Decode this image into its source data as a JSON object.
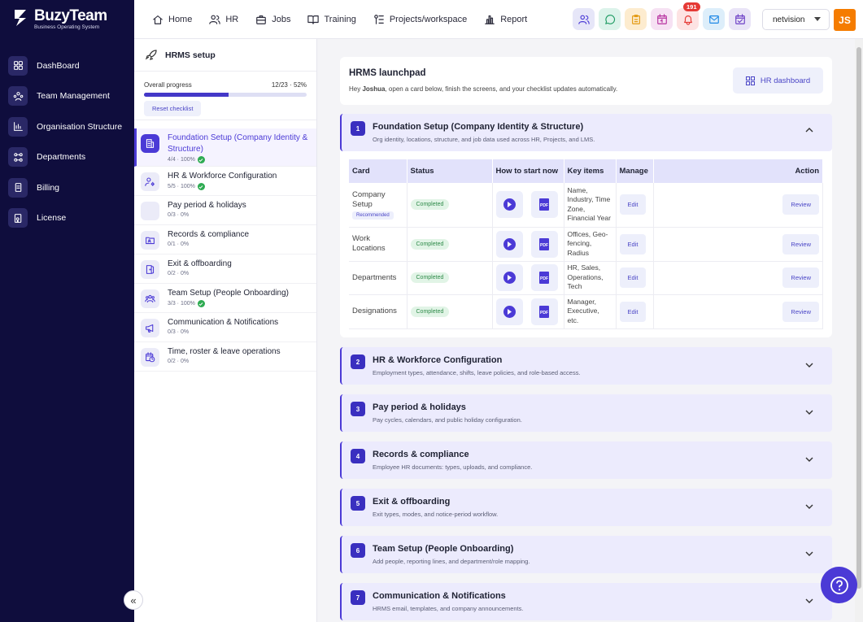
{
  "app": {
    "brand": "BuzyTeam",
    "tagline": "Business Operating System"
  },
  "leftnav": [
    {
      "label": "DashBoard",
      "icon": "dashboard-icon"
    },
    {
      "label": "Team Management",
      "icon": "team-icon"
    },
    {
      "label": "Organisation Structure",
      "icon": "org-chart-icon"
    },
    {
      "label": "Departments",
      "icon": "departments-icon"
    },
    {
      "label": "Billing",
      "icon": "billing-icon"
    },
    {
      "label": "License",
      "icon": "license-icon"
    }
  ],
  "collapse_glyph": "«",
  "topnav": [
    {
      "label": "Home",
      "icon": "home-icon"
    },
    {
      "label": "HR",
      "icon": "people-icon"
    },
    {
      "label": "Jobs",
      "icon": "briefcase-icon"
    },
    {
      "label": "Training",
      "icon": "book-icon"
    },
    {
      "label": "Projects/workspace",
      "icon": "projects-icon"
    },
    {
      "label": "Report",
      "icon": "bar-chart-icon"
    }
  ],
  "toolbar": {
    "icons": [
      {
        "name": "users-icon",
        "bg": "#e6e6f8",
        "color": "#4b3ad6"
      },
      {
        "name": "chat-icon",
        "bg": "#dcf3ea",
        "color": "#1e9b62"
      },
      {
        "name": "clipboard-icon",
        "bg": "#fdeccf",
        "color": "#e39a12"
      },
      {
        "name": "calendar-icon",
        "bg": "#f6e1f3",
        "color": "#b6309f"
      },
      {
        "name": "bell-icon",
        "bg": "#fde3e3",
        "color": "#e53935",
        "badge": "191"
      },
      {
        "name": "mail-icon",
        "bg": "#ddeefa",
        "color": "#1e88e5"
      },
      {
        "name": "calendar-check-icon",
        "bg": "#e9e4f7",
        "color": "#6d3fc6"
      }
    ],
    "tenant": "netvision",
    "avatar": "JS"
  },
  "setup": {
    "title": "HRMS setup",
    "progress_label": "Overall progress",
    "progress_value": "12/23 · 52%",
    "progress_fraction": 0.52,
    "reset_label": "Reset checklist",
    "steps": [
      {
        "title": "Foundation Setup (Company Identity & Structure)",
        "meta": "4/4 · 100%",
        "done": true,
        "active": true,
        "icon": "building-icon"
      },
      {
        "title": "HR & Workforce Configuration",
        "meta": "5/5 · 100%",
        "done": true,
        "icon": "user-cog-icon"
      },
      {
        "title": "Pay period & holidays",
        "meta": "0/3 · 0%",
        "done": false,
        "icon": "blank-icon"
      },
      {
        "title": "Records & compliance",
        "meta": "0/1 · 0%",
        "done": false,
        "icon": "folder-icon"
      },
      {
        "title": "Exit & offboarding",
        "meta": "0/2 · 0%",
        "done": false,
        "icon": "door-icon"
      },
      {
        "title": "Team Setup (People Onboarding)",
        "meta": "3/3 · 100%",
        "done": true,
        "icon": "group-icon"
      },
      {
        "title": "Communication & Notifications",
        "meta": "0/3 · 0%",
        "done": false,
        "icon": "megaphone-icon"
      },
      {
        "title": "Time, roster & leave operations",
        "meta": "0/2 · 0%",
        "done": false,
        "icon": "clock-calendar-icon"
      }
    ]
  },
  "launchpad": {
    "title": "HRMS launchpad",
    "sub_prefix": "Hey ",
    "user": "Joshua",
    "sub_suffix": ", open a card below, finish the screens, and your checklist updates automatically.",
    "dashboard_btn": "HR dashboard"
  },
  "sections": [
    {
      "num": "1",
      "title": "Foundation Setup (Company Identity & Structure)",
      "sub": "Org identity, locations, structure, and job data used across HR, Projects, and LMS.",
      "expanded": true
    },
    {
      "num": "2",
      "title": "HR & Workforce Configuration",
      "sub": "Employment types, attendance, shifts, leave policies, and role-based access."
    },
    {
      "num": "3",
      "title": "Pay period & holidays",
      "sub": "Pay cycles, calendars, and public holiday configuration."
    },
    {
      "num": "4",
      "title": "Records & compliance",
      "sub": "Employee HR documents: types, uploads, and compliance."
    },
    {
      "num": "5",
      "title": "Exit & offboarding",
      "sub": "Exit types, modes, and notice-period workflow."
    },
    {
      "num": "6",
      "title": "Team Setup (People Onboarding)",
      "sub": "Add people, reporting lines, and department/role mapping."
    },
    {
      "num": "7",
      "title": "Communication & Notifications",
      "sub": "HRMS email, templates, and company announcements."
    }
  ],
  "table": {
    "headers": {
      "card": "Card",
      "status": "Status",
      "how": "How to start now",
      "key": "Key items",
      "manage": "Manage",
      "action": "Action"
    },
    "pdf_label": "PDF",
    "rows": [
      {
        "card": "Company Setup",
        "badge": "Recommended",
        "status": "Completed",
        "key": "Name, Industry, Time Zone, Financial Year",
        "manage": "Edit",
        "action": "Review"
      },
      {
        "card": "Work Locations",
        "status": "Completed",
        "key": "Offices, Geo-fencing, Radius",
        "manage": "Edit",
        "action": "Review"
      },
      {
        "card": "Departments",
        "status": "Completed",
        "key": "HR, Sales, Operations, Tech",
        "manage": "Edit",
        "action": "Review"
      },
      {
        "card": "Designations",
        "status": "Completed",
        "key": "Manager, Executive, etc.",
        "manage": "Edit",
        "action": "Review"
      }
    ]
  },
  "help_icon": "question-icon"
}
